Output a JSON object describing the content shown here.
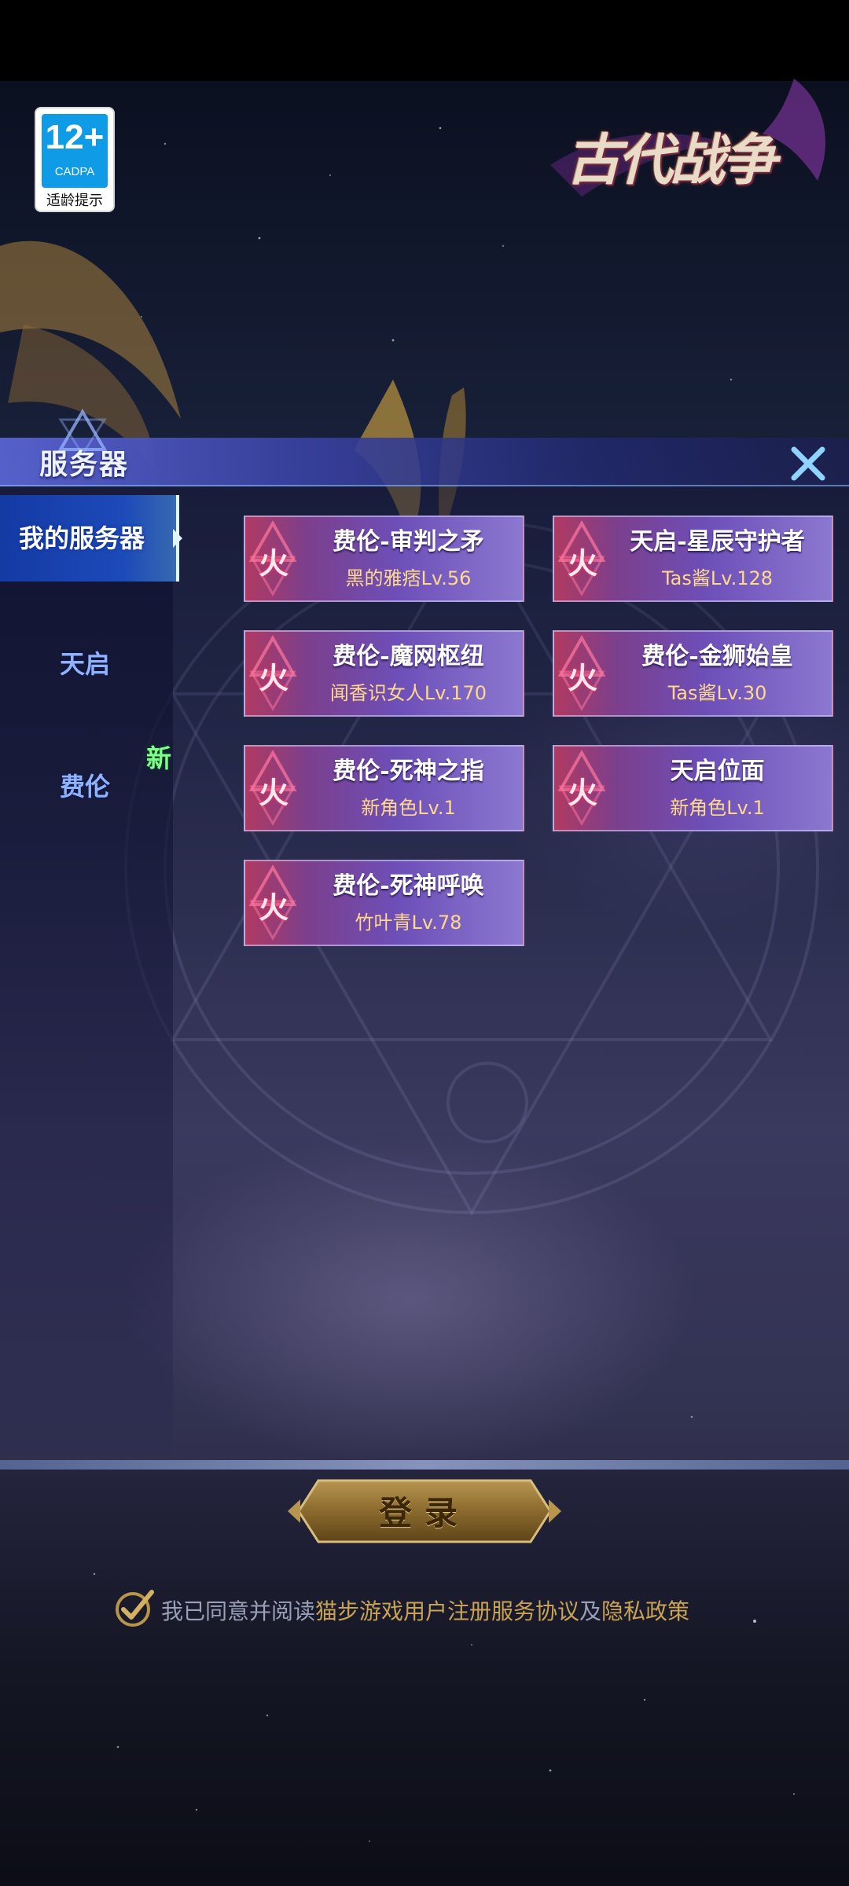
{
  "age_badge": {
    "age": "12+",
    "org": "CADPA",
    "hint": "适龄提示"
  },
  "logo": {
    "text": "古代战争"
  },
  "panel": {
    "title": "服务器",
    "close_icon": "close-x-icon"
  },
  "sidebar": {
    "active": "我的服务器",
    "items": [
      {
        "label": "天启"
      },
      {
        "label": "费伦",
        "badge": "新"
      }
    ]
  },
  "servers": [
    {
      "badge": "火",
      "name": "费伦-审判之矛",
      "role": "黑的雅痞",
      "level": "Lv.56"
    },
    {
      "badge": "火",
      "name": "天启-星辰守护者",
      "role": "Tas酱",
      "level": "Lv.128"
    },
    {
      "badge": "火",
      "name": "费伦-魔网枢纽",
      "role": "闻香识女人",
      "level": "Lv.170"
    },
    {
      "badge": "火",
      "name": "费伦-金狮始皇",
      "role": "Tas酱",
      "level": "Lv.30"
    },
    {
      "badge": "火",
      "name": "费伦-死神之指",
      "role": "新角色",
      "level": "Lv.1"
    },
    {
      "badge": "火",
      "name": "天启位面",
      "role": "新角色",
      "level": "Lv.1"
    },
    {
      "badge": "火",
      "name": "费伦-死神呼唤",
      "role": "竹叶青",
      "level": "Lv.78"
    }
  ],
  "login": {
    "label": "登录"
  },
  "agreement": {
    "prefix": "我已同意并阅读",
    "link1": "猫步游戏用户注册服务协议",
    "and": "及",
    "link2": "隐私政策",
    "checked": true
  },
  "colors": {
    "accent_gold": "#c9a353",
    "card_left": "#b03a62",
    "card_right": "#8b78d0",
    "new_badge": "#7dff8a"
  }
}
